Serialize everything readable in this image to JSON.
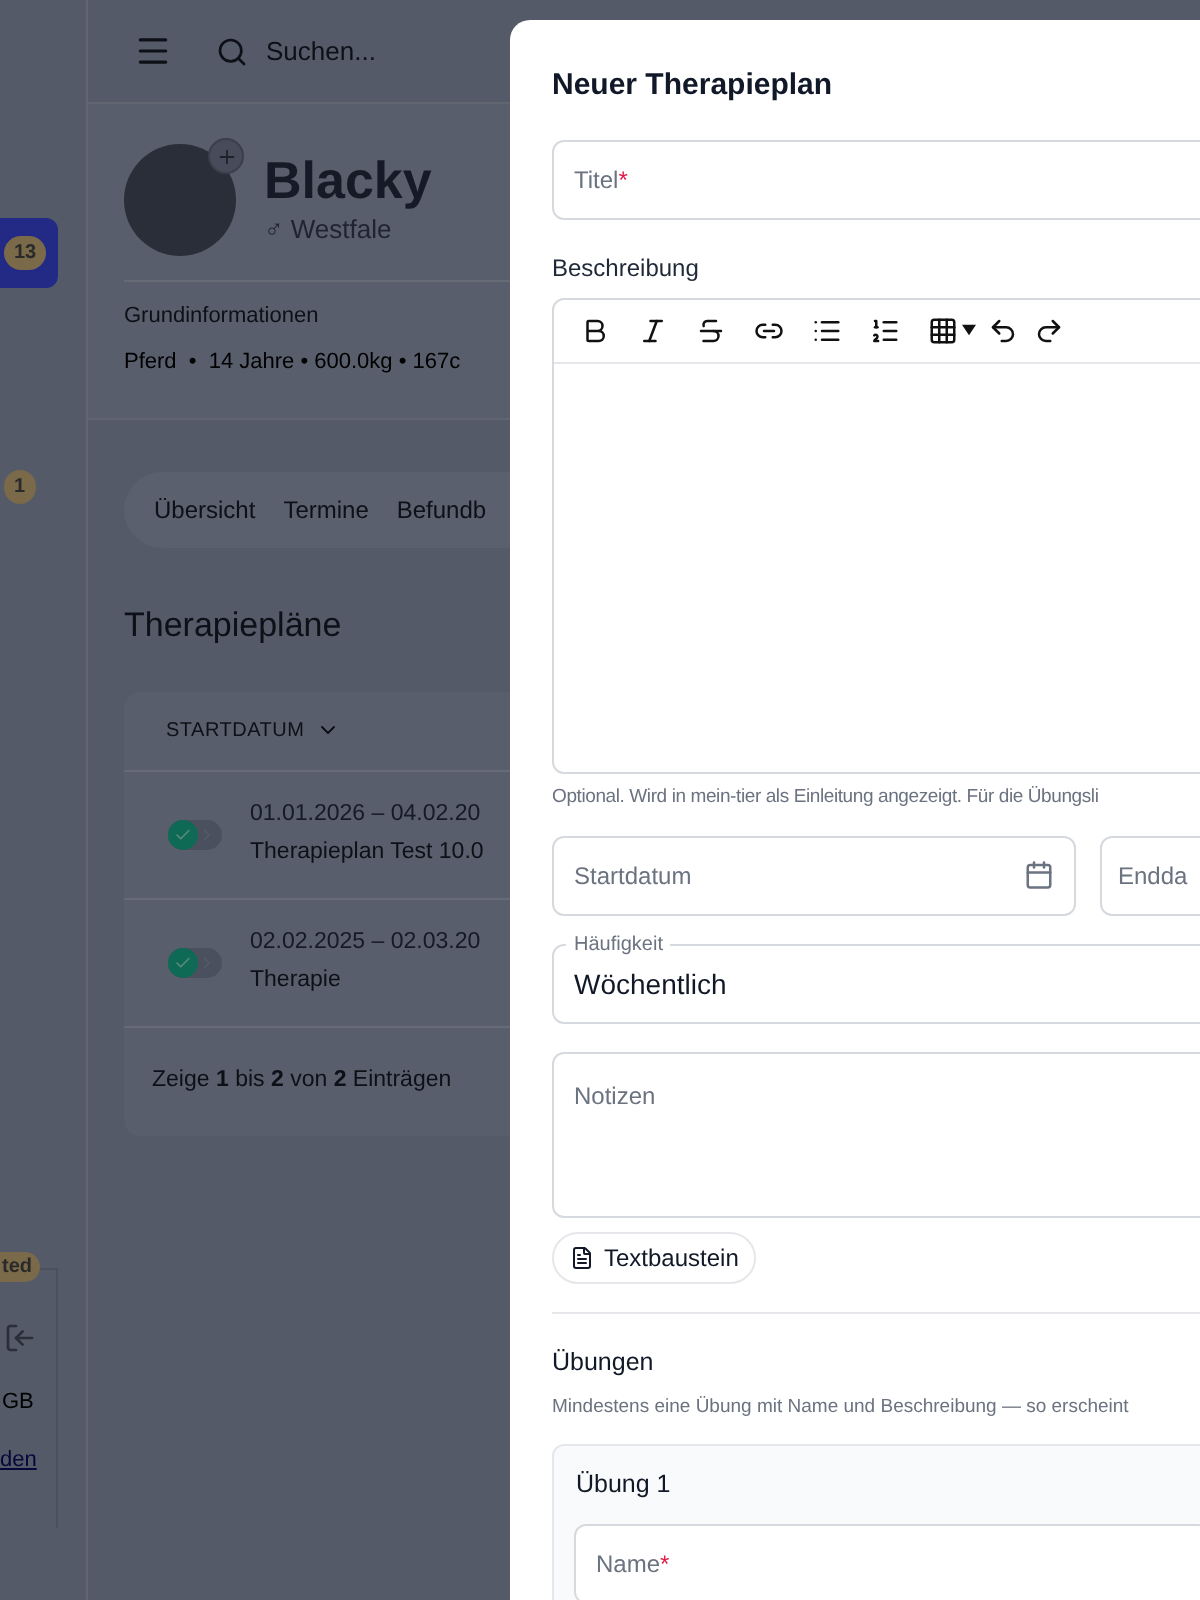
{
  "sidebar": {
    "items": [
      {
        "badge": "13",
        "selected": true
      },
      {
        "badge": "1",
        "selected": false
      }
    ],
    "footer": {
      "badge": "ted",
      "storage": "GB",
      "link": "den"
    }
  },
  "header": {
    "search": {
      "placeholder": "Suchen..."
    }
  },
  "animal": {
    "name": "Blacky",
    "breed": "♂ Westfale",
    "info_label": "Grundinformationen",
    "info": "Pferd  •  14 Jahre • 600.0kg • 167c"
  },
  "tabs": [
    {
      "label": "Übersicht",
      "selected": false
    },
    {
      "label": "Termine",
      "selected": false
    },
    {
      "label": "Befundb",
      "selected": false
    }
  ],
  "section_title": "Therapiepläne",
  "table": {
    "sort_column": "STARTDATUM",
    "rows": [
      {
        "dates": "01.01.2026 – 04.02.20",
        "title": "Therapieplan Test 10.0",
        "done": true
      },
      {
        "dates": "02.02.2025 – 02.03.20",
        "title": "Therapie",
        "done": true
      }
    ],
    "footer": "Zeige **1** bis **2** von **2** Einträgen"
  },
  "drawer": {
    "title": "Neuer Therapieplan",
    "title_field": {
      "placeholder": "Titel",
      "required_mark": "*"
    },
    "description": {
      "label": "Beschreibung",
      "helper": "Optional. Wird in mein-tier als Einleitung angezeigt. Für die Übungsli"
    },
    "start_date": {
      "placeholder": "Startdatum"
    },
    "end_date": {
      "placeholder": "Endda"
    },
    "frequency": {
      "label": "Häufigkeit",
      "value": "Wöchentlich"
    },
    "notes": {
      "placeholder": "Notizen"
    },
    "snippet_button": "Textbaustein",
    "exercises": {
      "title": "Übungen",
      "helper": "Mindestens eine Übung mit Name und Beschreibung — so erscheint",
      "items": [
        {
          "title": "Übung 1",
          "name_field": {
            "placeholder": "Name",
            "required_mark": "*"
          }
        }
      ]
    }
  }
}
